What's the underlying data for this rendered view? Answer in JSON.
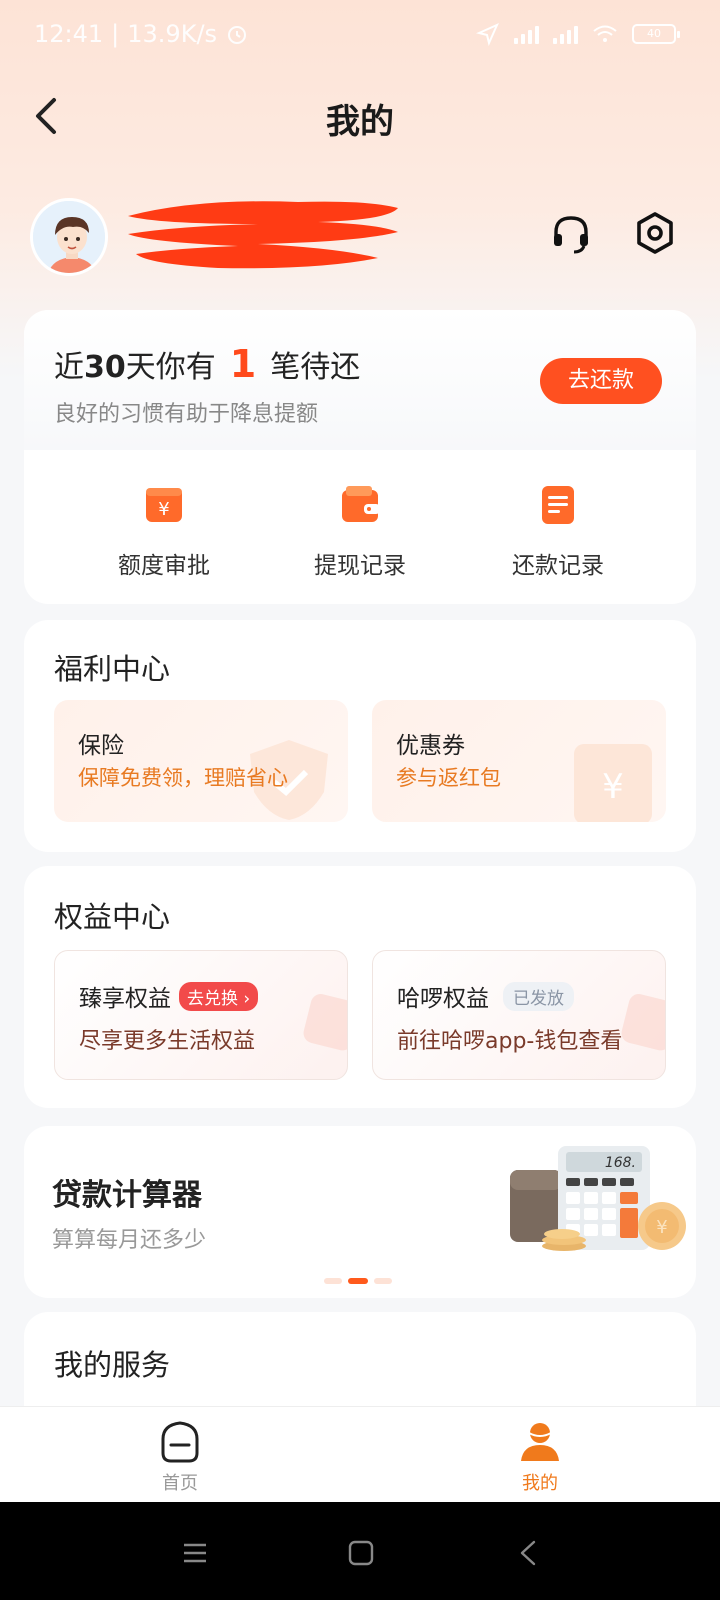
{
  "status_bar": {
    "time": "12:41",
    "speed": "13.9K/s",
    "battery": "40"
  },
  "header": {
    "title": "我的"
  },
  "repay": {
    "title_prefix": "近",
    "title_days": "30",
    "title_mid": "天你有",
    "count": "1",
    "title_suffix": "笔待还",
    "subtitle": "良好的习惯有助于降息提额",
    "button": "去还款"
  },
  "quick_actions": [
    {
      "label": "额度审批",
      "icon": "quota-approval-icon"
    },
    {
      "label": "提现记录",
      "icon": "withdraw-record-icon"
    },
    {
      "label": "还款记录",
      "icon": "repay-record-icon"
    }
  ],
  "welfare": {
    "title": "福利中心",
    "tiles": [
      {
        "title": "保险",
        "subtitle": "保障免费领，理赔省心"
      },
      {
        "title": "优惠券",
        "subtitle": "参与返红包"
      }
    ]
  },
  "rights": {
    "title": "权益中心",
    "tiles": [
      {
        "title": "臻享权益",
        "badge": "去兑换 ›",
        "subtitle": "尽享更多生活权益"
      },
      {
        "title": "哈啰权益",
        "badge": "已发放",
        "subtitle": "前往哈啰app-钱包查看"
      }
    ]
  },
  "calculator": {
    "title": "贷款计算器",
    "subtitle": "算算每月还多少",
    "display": "168."
  },
  "services": {
    "title": "我的服务"
  },
  "tabs": [
    {
      "label": "首页",
      "active": false
    },
    {
      "label": "我的",
      "active": true
    }
  ],
  "colors": {
    "accent": "#ff5020",
    "warm_text": "#e87a22",
    "tab_active": "#f07a1c",
    "tab_inactive": "#999999"
  }
}
